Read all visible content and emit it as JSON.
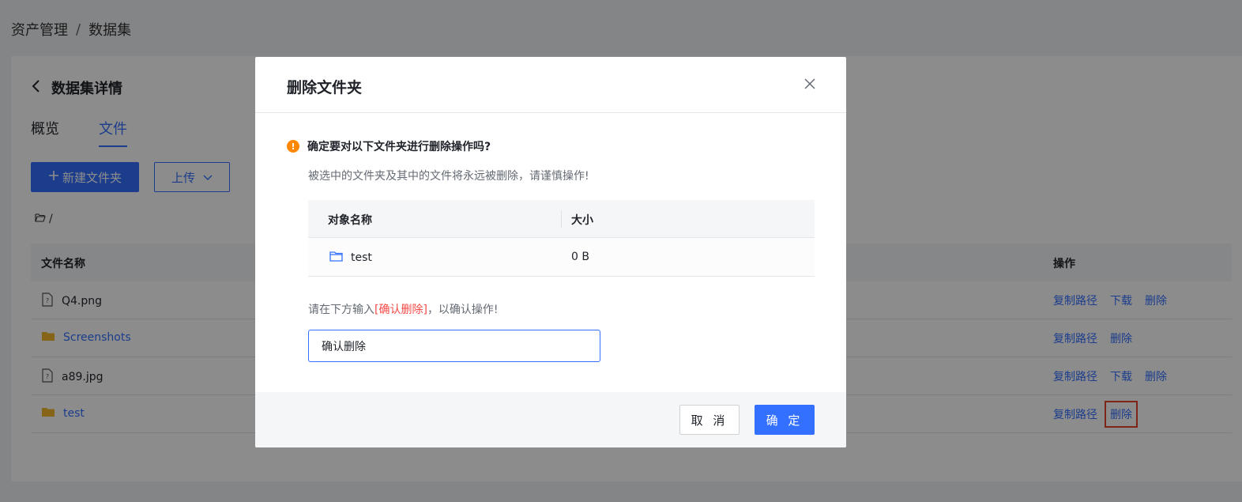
{
  "breadcrumb": {
    "root": "资产管理",
    "separator": "/",
    "current": "数据集"
  },
  "detail": {
    "title": "数据集详情",
    "back_icon": "chevron-left-icon",
    "tabs": [
      {
        "label": "概览",
        "active": false
      },
      {
        "label": "文件",
        "active": true
      }
    ],
    "new_folder_button": "新建文件夹",
    "upload_button": "上传",
    "path": "/"
  },
  "file_table": {
    "headers": {
      "name": "文件名称",
      "ops": "操作"
    },
    "rows": [
      {
        "name": "Q4.png",
        "type": "file",
        "ops": [
          "复制路径",
          "下载",
          "删除"
        ]
      },
      {
        "name": "Screenshots",
        "type": "folder",
        "ops": [
          "复制路径",
          "删除"
        ]
      },
      {
        "name": "a89.jpg",
        "type": "file",
        "ops": [
          "复制路径",
          "下载",
          "删除"
        ]
      },
      {
        "name": "test",
        "type": "folder",
        "ops": [
          "复制路径",
          "删除"
        ]
      }
    ]
  },
  "modal": {
    "title": "删除文件夹",
    "close_icon": "close-icon",
    "warning_icon": "exclamation-icon",
    "warning_mark": "!",
    "warning_title": "确定要对以下文件夹进行删除操作吗?",
    "warning_sub": "被选中的文件夹及其中的文件将永远被删除，请谨慎操作!",
    "table": {
      "headers": {
        "name": "对象名称",
        "size": "大小"
      },
      "rows": [
        {
          "name": "test",
          "size": "0 B"
        }
      ]
    },
    "prompt_prefix": "请在下方输入",
    "prompt_keyword": "[确认删除]",
    "prompt_suffix": "，以确认操作!",
    "input_value": "确认删除",
    "cancel_button": "取 消",
    "confirm_button": "确 定"
  },
  "colors": {
    "primary": "#3370ff",
    "danger": "#f54a45",
    "warning": "#ff8800",
    "highlight": "#e5442d"
  }
}
